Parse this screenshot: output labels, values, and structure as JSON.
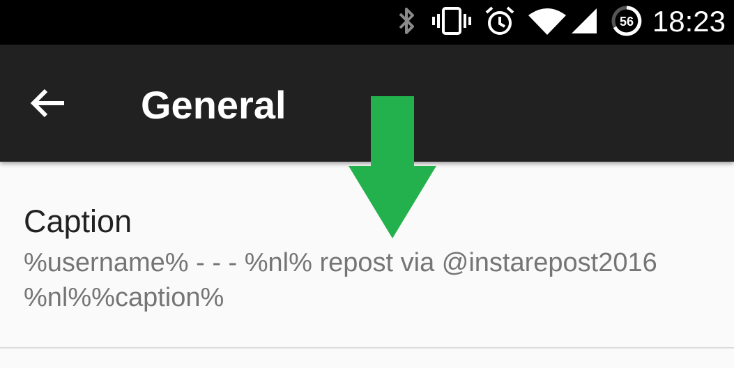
{
  "status_bar": {
    "time": "18:23",
    "battery_level": "56",
    "icons": [
      "bluetooth-icon",
      "vibrate-icon",
      "alarm-icon",
      "wifi-icon",
      "signal-icon",
      "battery-icon"
    ]
  },
  "toolbar": {
    "back_icon": "arrow-back-icon",
    "title": "General"
  },
  "preferences": [
    {
      "title": "Caption",
      "summary": "%username% - - - %nl% repost via @instarepost2016 %nl%%caption%"
    }
  ],
  "colors": {
    "status_bar": "#000000",
    "toolbar": "#212121",
    "background": "#fafafa",
    "title_text": "#212121",
    "summary_text": "#757575",
    "annotation_arrow": "#22b14c"
  }
}
